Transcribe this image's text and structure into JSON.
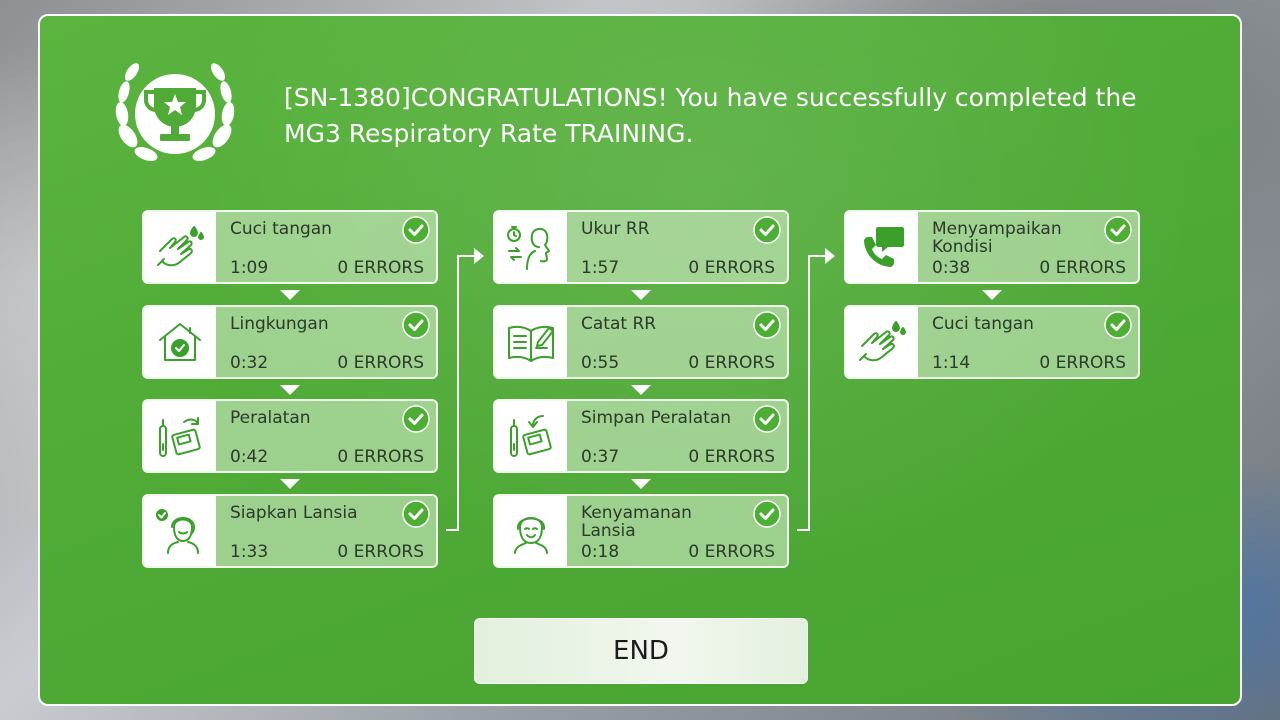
{
  "headline": {
    "text": "[SN-1380]CONGRATULATIONS! You have successfully completed the MG3 Respiratory Rate TRAINING."
  },
  "steps": [
    {
      "title": "Cuci tangan",
      "time": "1:09",
      "errors": "0 ERRORS",
      "icon": "handwash-icon"
    },
    {
      "title": "Lingkungan",
      "time": "0:32",
      "errors": "0 ERRORS",
      "icon": "house-check-icon"
    },
    {
      "title": "Peralatan",
      "time": "0:42",
      "errors": "0 ERRORS",
      "icon": "equipment-icon"
    },
    {
      "title": "Siapkan Lansia",
      "time": "1:33",
      "errors": "0 ERRORS",
      "icon": "elderly-check-icon"
    },
    {
      "title": "Ukur RR",
      "time": "1:57",
      "errors": "0 ERRORS",
      "icon": "breathing-timer-icon"
    },
    {
      "title": "Catat RR",
      "time": "0:55",
      "errors": "0 ERRORS",
      "icon": "notebook-icon"
    },
    {
      "title": "Simpan Peralatan",
      "time": "0:37",
      "errors": "0 ERRORS",
      "icon": "store-equipment-icon"
    },
    {
      "title": "Kenyamanan Lansia",
      "time": "0:18",
      "errors": "0 ERRORS",
      "icon": "elderly-face-icon"
    },
    {
      "title": "Menyampaikan Kondisi",
      "time": "0:38",
      "errors": "0 ERRORS",
      "icon": "phone-chat-icon"
    },
    {
      "title": "Cuci tangan",
      "time": "1:14",
      "errors": "0 ERRORS",
      "icon": "handwash-icon"
    }
  ],
  "end_button": {
    "label": "END"
  },
  "colors": {
    "panel": "#4faa36",
    "check": "#4caf33",
    "icon": "#3aa02a"
  }
}
